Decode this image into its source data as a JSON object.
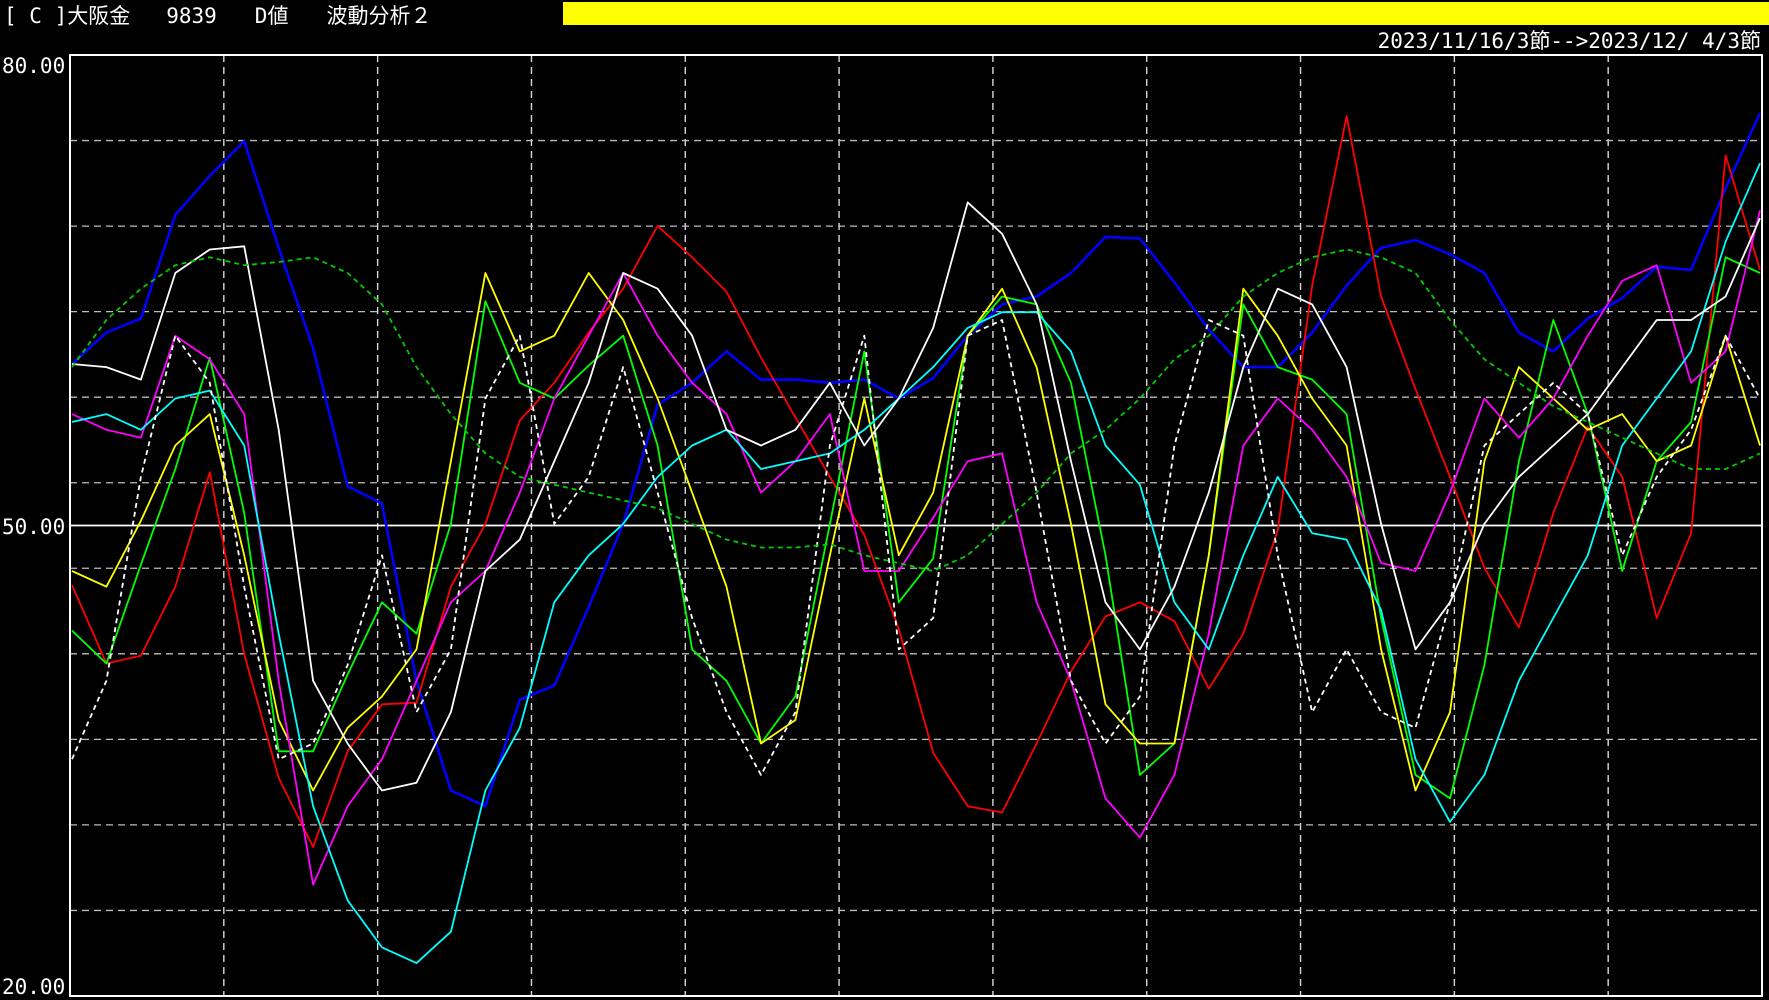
{
  "header": {
    "market_code": "[ C ]大阪金",
    "code_number": "9839",
    "value_type": "D値",
    "analysis_name": "波動分析２",
    "date_range": "2023/11/16/3節-->2023/12/ 4/3節",
    "accent_bar_color": "#ffff00"
  },
  "chart_data": {
    "type": "line",
    "ylim": [
      20,
      80
    ],
    "y_tick_labels": [
      "80.00",
      "50.00",
      "20.00"
    ],
    "grid": true,
    "x": [
      0,
      1,
      2,
      3,
      4,
      5,
      6,
      7,
      8,
      9,
      10,
      11,
      12,
      13,
      14,
      15,
      16,
      17,
      18,
      19,
      20,
      21,
      22,
      23,
      24,
      25,
      26,
      27,
      28,
      29,
      30,
      31,
      32,
      33,
      34,
      35,
      36,
      37,
      38,
      39,
      40,
      41,
      42,
      43,
      44,
      45,
      46,
      47,
      48,
      49
    ],
    "series": [
      {
        "color": "#0000ff",
        "style": "solid",
        "values": [
          60.3,
          62.3,
          63.2,
          69.8,
          72.3,
          74.5,
          67.7,
          61.3,
          52.5,
          51.4,
          40.1,
          33.1,
          32.1,
          38.9,
          39.8,
          44.8,
          50.1,
          57.7,
          59.1,
          61.1,
          59.3,
          59.3,
          59.1,
          59.3,
          58.1,
          59.4,
          62.1,
          64.1,
          64.6,
          66.1,
          68.4,
          68.3,
          65.5,
          62.5,
          60.1,
          60.1,
          62.3,
          65.3,
          67.7,
          68.2,
          67.3,
          66.1,
          62.3,
          61.1,
          63.2,
          64.5,
          66.5,
          66.3,
          71.5,
          76.3
        ]
      },
      {
        "color": "#ff0000",
        "style": "solid",
        "values": [
          46.2,
          41.2,
          41.7,
          46.1,
          53.4,
          41.8,
          33.9,
          29.5,
          35.6,
          38.6,
          38.7,
          46.1,
          50.1,
          56.7,
          59.1,
          62.3,
          65.1,
          69.1,
          67.1,
          64.9,
          60.7,
          56.9,
          53.1,
          49.4,
          43.4,
          35.5,
          32.1,
          31.7,
          36.1,
          40.7,
          44.2,
          45.1,
          43.9,
          39.6,
          43.1,
          49.7,
          65.3,
          76.1,
          64.6,
          58.7,
          53.1,
          47.3,
          43.5,
          50.8,
          56.3,
          53.1,
          44.1,
          49.5,
          73.6,
          66.3
        ]
      },
      {
        "color": "#00ff00",
        "style": "solid",
        "values": [
          43.3,
          41.2,
          47.5,
          53.6,
          60.7,
          50.8,
          35.6,
          35.6,
          40.5,
          45.1,
          43.1,
          50.1,
          64.3,
          59.1,
          58.1,
          60.2,
          62.1,
          55.1,
          42.1,
          40.1,
          36.1,
          39.1,
          50.1,
          61.1,
          45.1,
          47.9,
          62.1,
          64.6,
          64.1,
          59.1,
          48.1,
          34.1,
          36.1,
          48.1,
          64.1,
          60.1,
          59.3,
          57.1,
          44.1,
          34.1,
          32.6,
          41.1,
          54.1,
          63.1,
          57.1,
          47.1,
          54.1,
          56.6,
          67.1,
          66.1
        ]
      },
      {
        "color": "#ffff00",
        "style": "solid",
        "values": [
          47.1,
          46.1,
          50.3,
          55.1,
          57.1,
          48.1,
          37.6,
          33.1,
          37.1,
          39.1,
          42.1,
          54.1,
          66.1,
          61.1,
          62.1,
          66.1,
          63.1,
          58.1,
          52.1,
          46.1,
          36.1,
          37.6,
          48.1,
          58.1,
          48.1,
          52.1,
          62.1,
          65.1,
          60.1,
          50.1,
          38.6,
          36.1,
          36.1,
          48.1,
          65.1,
          62.1,
          58.1,
          55.1,
          42.1,
          33.1,
          38.1,
          54.1,
          60.1,
          58.1,
          56.1,
          57.1,
          54.1,
          55.1,
          62.1,
          55.1
        ]
      },
      {
        "color": "#ff00ff",
        "style": "solid",
        "values": [
          57.1,
          56.1,
          55.6,
          62.1,
          60.6,
          57.1,
          40.1,
          27.1,
          32.1,
          35.1,
          40.1,
          45.1,
          47.1,
          52.1,
          58.1,
          62.1,
          66.1,
          62.1,
          59.1,
          57.1,
          52.1,
          54.1,
          57.1,
          47.1,
          47.1,
          50.5,
          54.1,
          54.6,
          45.1,
          40.1,
          32.6,
          30.1,
          34.1,
          43.1,
          55.1,
          58.1,
          56.1,
          53.1,
          47.6,
          47.1,
          52.1,
          58.1,
          55.6,
          58.1,
          62.1,
          65.6,
          66.6,
          59.1,
          61.1,
          70.1
        ]
      },
      {
        "color": "#00ffff",
        "style": "solid",
        "values": [
          56.6,
          57.1,
          56.1,
          58.1,
          58.6,
          55.1,
          43.1,
          32.1,
          26.1,
          23.1,
          22.1,
          24.1,
          33.1,
          37.1,
          45.1,
          48.1,
          50.1,
          53.1,
          55.1,
          56.1,
          53.6,
          54.1,
          54.6,
          56.1,
          58.1,
          60.1,
          62.6,
          63.6,
          63.6,
          61.1,
          55.1,
          52.6,
          45.1,
          42.1,
          48.1,
          53.1,
          49.5,
          49.1,
          44.6,
          35.1,
          31.1,
          34.1,
          40.1,
          44.1,
          48.1,
          55.1,
          58.1,
          61.1,
          68.1,
          73.1
        ]
      },
      {
        "color": "#ffffff",
        "style": "solid",
        "values": [
          60.3,
          60.1,
          59.3,
          66.1,
          67.6,
          67.8,
          56.1,
          40.1,
          36.1,
          33.1,
          33.6,
          38.1,
          47.1,
          49.1,
          54.1,
          59.1,
          66.1,
          65.1,
          62.1,
          56.1,
          55.1,
          56.1,
          59.1,
          55.1,
          58.1,
          62.6,
          70.6,
          68.6,
          64.1,
          54.1,
          45.1,
          42.1,
          46.1,
          52.1,
          60.1,
          65.1,
          64.1,
          60.1,
          50.1,
          42.1,
          45.1,
          50.1,
          53.1,
          55.1,
          57.1,
          60.1,
          63.1,
          63.1,
          64.6,
          69.6
        ]
      },
      {
        "color": "#ffffff",
        "style": "dashed",
        "values": [
          35.1,
          40.1,
          53.1,
          62.1,
          59.1,
          46.1,
          35.1,
          36.1,
          41.1,
          48.1,
          38.1,
          42.1,
          58.1,
          62.1,
          50.1,
          53.1,
          60.1,
          52.1,
          44.1,
          38.1,
          34.1,
          38.1,
          55.1,
          62.1,
          42.1,
          44.1,
          62.1,
          63.1,
          52.1,
          40.1,
          36.1,
          39.1,
          55.1,
          63.1,
          62.1,
          48.1,
          38.1,
          42.1,
          38.1,
          37.1,
          45.1,
          55.1,
          57.1,
          59.1,
          57.1,
          48.1,
          53.1,
          56.1,
          62.1,
          58.1
        ]
      },
      {
        "color": "#00cc00",
        "style": "dashed",
        "values": [
          60.1,
          63.1,
          65.1,
          66.6,
          67.1,
          66.6,
          66.8,
          67.1,
          66.1,
          64.1,
          60.1,
          57.1,
          54.6,
          53.1,
          52.6,
          52.1,
          51.6,
          51.1,
          50.1,
          49.1,
          48.6,
          48.6,
          48.8,
          48.1,
          47.6,
          47.1,
          48.1,
          50.1,
          52.1,
          54.6,
          56.1,
          58.1,
          60.6,
          62.1,
          64.6,
          66.1,
          67.1,
          67.6,
          67.1,
          66.1,
          63.1,
          60.6,
          59.1,
          57.6,
          56.6,
          55.6,
          54.6,
          53.6,
          53.6,
          54.6
        ]
      }
    ]
  }
}
